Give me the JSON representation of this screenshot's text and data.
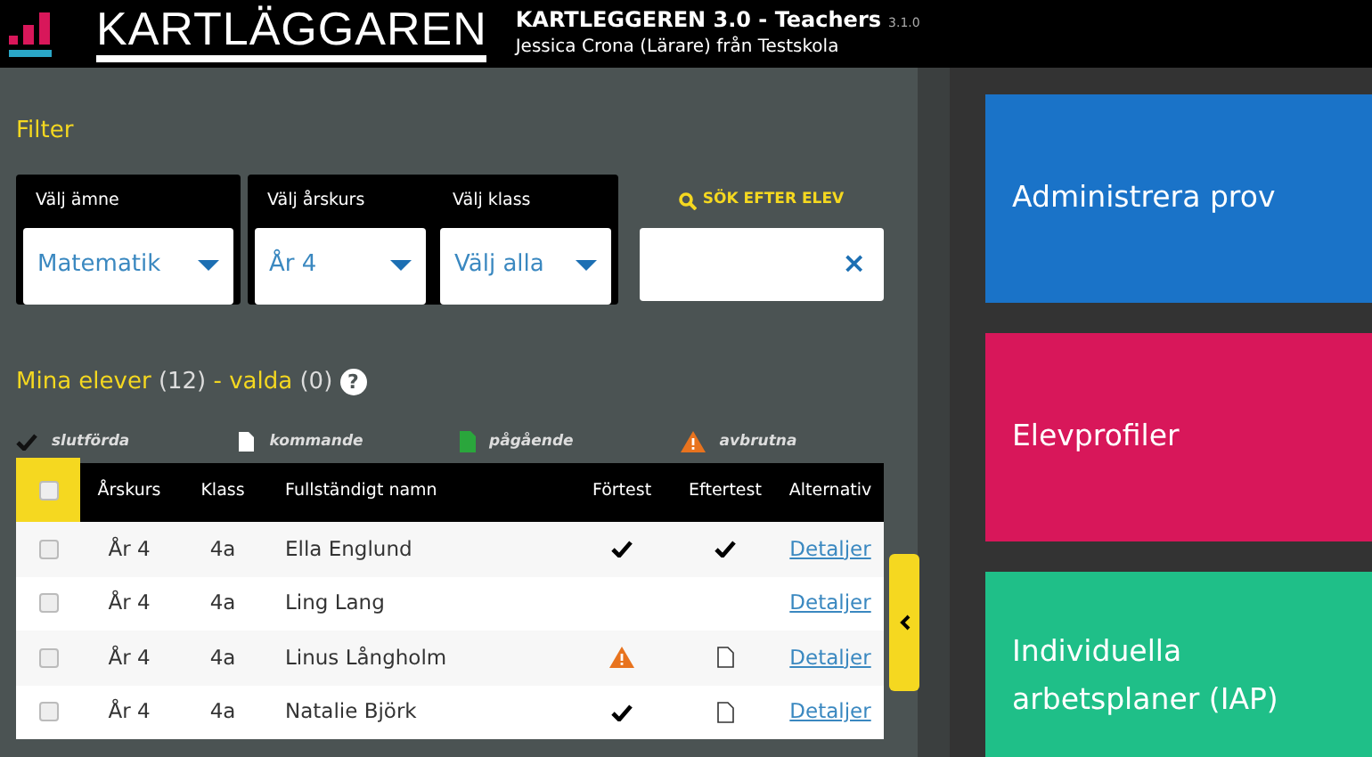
{
  "header": {
    "logo": "KARTLÄGGAREN",
    "app_title": "KARTLEGGEREN 3.0 - Teachers",
    "version": "3.1.0",
    "user": "Jessica Crona (Lärare) från Testskola"
  },
  "filter": {
    "title": "Filter",
    "select_groups": [
      [
        {
          "label": "Välj ämne",
          "value": "Matematik"
        }
      ],
      [
        {
          "label": "Välj årskurs",
          "value": "År 4"
        },
        {
          "label": "Välj klass",
          "value": "Välj alla"
        }
      ]
    ],
    "search": {
      "label": "SÖK EFTER ELEV",
      "clear": "×"
    }
  },
  "students": {
    "title": "Mina elever",
    "count": "(12)",
    "separator": "-",
    "selected_label": "valda",
    "selected_count": "(0)",
    "help": "?",
    "legend": [
      {
        "kind": "done",
        "label": "slutförda"
      },
      {
        "kind": "upcoming",
        "label": "kommande"
      },
      {
        "kind": "ongoing",
        "label": "pågående"
      },
      {
        "kind": "aborted",
        "label": "avbrutna"
      }
    ],
    "select_all": {
      "checked": false
    },
    "columns": [
      "Årskurs",
      "Klass",
      "Fullständigt namn",
      "Förtest",
      "Eftertest",
      "Alternativ"
    ],
    "rows": [
      {
        "checked": false,
        "grade": "År 4",
        "class": "4a",
        "name": "Ella Englund",
        "pretest": {
          "kind": "done"
        },
        "posttest": {
          "kind": "done"
        },
        "link": "Detaljer"
      },
      {
        "checked": false,
        "grade": "År 4",
        "class": "4a",
        "name": "Ling Lang",
        "link": "Detaljer"
      },
      {
        "checked": false,
        "grade": "År 4",
        "class": "4a",
        "name": "Linus Långholm",
        "pretest": {
          "kind": "aborted"
        },
        "posttest": {
          "kind": "upcoming"
        },
        "link": "Detaljer"
      },
      {
        "checked": false,
        "grade": "År 4",
        "class": "4a",
        "name": "Natalie Björk",
        "pretest": {
          "kind": "done"
        },
        "posttest": {
          "kind": "upcoming"
        },
        "link": "Detaljer"
      }
    ]
  },
  "tiles": [
    {
      "label": "Administrera prov",
      "color": "#1a73c8"
    },
    {
      "label": "Elevprofiler",
      "color": "#d8175a"
    },
    {
      "label": "Individuella arbetsplaner (IAP)",
      "color": "#1fbf88"
    }
  ]
}
